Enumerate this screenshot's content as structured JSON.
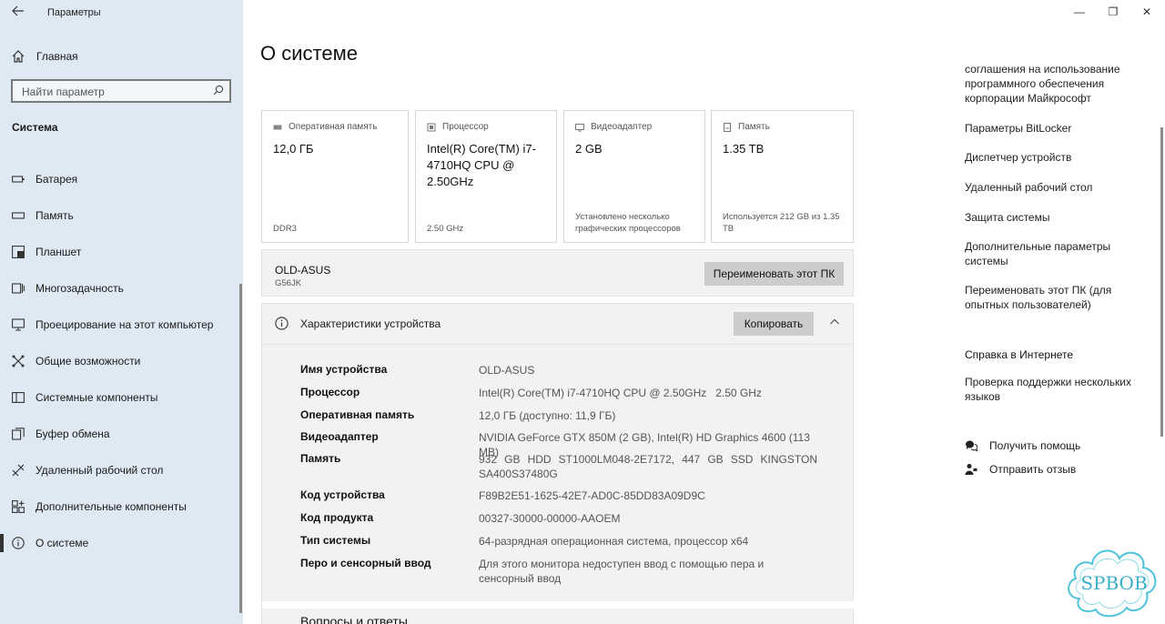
{
  "window": {
    "title": "Параметры",
    "minimize_glyph": "—",
    "maximize_glyph": "❐",
    "close_glyph": "✕"
  },
  "sidebar": {
    "home_label": "Главная",
    "search_placeholder": "Найти параметр",
    "section_title": "Система",
    "items": [
      {
        "label": "Батарея",
        "icon": "battery-icon"
      },
      {
        "label": "Память",
        "icon": "storage-icon"
      },
      {
        "label": "Планшет",
        "icon": "tablet-icon"
      },
      {
        "label": "Многозадачность",
        "icon": "multitasking-icon"
      },
      {
        "label": "Проецирование на этот компьютер",
        "icon": "projecting-icon"
      },
      {
        "label": "Общие возможности",
        "icon": "shared-experiences-icon"
      },
      {
        "label": "Системные компоненты",
        "icon": "system-components-icon"
      },
      {
        "label": "Буфер обмена",
        "icon": "clipboard-icon"
      },
      {
        "label": "Удаленный рабочий стол",
        "icon": "remote-desktop-icon"
      },
      {
        "label": "Дополнительные компоненты",
        "icon": "optional-features-icon"
      },
      {
        "label": "О системе",
        "icon": "about-icon",
        "selected": true
      }
    ]
  },
  "main": {
    "page_title": "О системе",
    "cards": [
      {
        "header": "Оперативная память",
        "value": "12,0 ГБ",
        "sub": "DDR3",
        "icon": "ram-icon"
      },
      {
        "header": "Процессор",
        "value": "Intel(R) Core(TM) i7-4710HQ CPU @ 2.50GHz",
        "sub": "2.50 GHz",
        "icon": "cpu-icon"
      },
      {
        "header": "Видеоадаптер",
        "value": "2 GB",
        "sub": "Установлено несколько графических процессоров",
        "icon": "gpu-icon"
      },
      {
        "header": "Память",
        "value": "1.35 TB",
        "sub": "Используется 212 GB из 1.35 TB",
        "icon": "storage-card-icon"
      }
    ],
    "device": {
      "name": "OLD-ASUS",
      "model": "G56JK",
      "rename_button": "Переименовать этот ПК"
    },
    "specs": {
      "title": "Характеристики устройства",
      "copy_button": "Копировать",
      "rows": [
        {
          "key": "Имя устройства",
          "value": "OLD-ASUS"
        },
        {
          "key": "Процессор",
          "value": "Intel(R) Core(TM) i7-4710HQ CPU @ 2.50GHz   2.50 GHz"
        },
        {
          "key": "Оперативная память",
          "value": "12,0 ГБ (доступно: 11,9 ГБ)"
        },
        {
          "key": "Видеоадаптер",
          "value": "NVIDIA GeForce GTX 850M (2 GB), Intel(R) HD Graphics 4600 (113 MB)"
        },
        {
          "key": "Память",
          "value": "932 GB HDD ST1000LM048-2E7172, 447 GB SSD KINGSTON SA400S37480G"
        },
        {
          "key": "Код устройства",
          "value": "F89B2E51-1625-42E7-AD0C-85DD83A09D9C"
        },
        {
          "key": "Код продукта",
          "value": "00327-30000-00000-AAOEM"
        },
        {
          "key": "Тип системы",
          "value": "64-разрядная операционная система, процессор x64"
        },
        {
          "key": "Перо и сенсорный ввод",
          "value": "Для этого монитора недоступен ввод с помощью пера и сенсорный ввод"
        }
      ],
      "next_section": "Вопросы и ответы"
    }
  },
  "right": {
    "links": [
      "соглашения на использование программного обеспечения корпорации Майкрософт",
      "Параметры BitLocker",
      "Диспетчер устройств",
      "Удаленный рабочий стол",
      "Защита системы",
      "Дополнительные параметры системы",
      "Переименовать этот ПК (для опытных пользователей)"
    ],
    "help_heading": "Справка в Интернете",
    "help_link": "Проверка поддержки нескольких языков",
    "get_help": "Получить помощь",
    "feedback": "Отправить отзыв"
  },
  "watermark": {
    "text": "SPBOB"
  }
}
